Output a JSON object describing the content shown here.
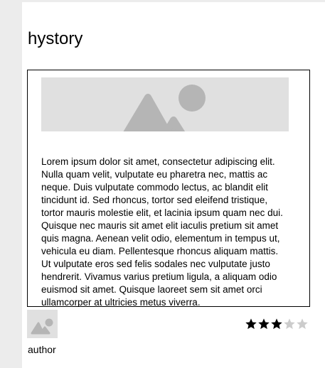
{
  "title": "hystory",
  "card": {
    "image_icon": "image-placeholder-icon",
    "body": "Lorem ipsum dolor sit amet, consectetur adipiscing elit. Nulla quam velit, vulputate eu pharetra nec, mattis ac neque. Duis vulputate commodo lectus, ac blandit elit tincidunt id. Sed rhoncus, tortor sed eleifend tristique, tortor mauris molestie elit, et lacinia ipsum quam nec dui. Quisque nec mauris sit amet elit iaculis pretium sit amet quis magna. Aenean velit odio, elementum in tempus ut, vehicula eu diam. Pellentesque rhoncus aliquam mattis. Ut vulputate eros sed felis sodales nec vulputate justo hendrerit. Vivamus varius pretium ligula, a aliquam odio euismod sit amet. Quisque laoreet sem sit amet orci ullamcorper at ultricies metus viverra."
  },
  "author": {
    "avatar_icon": "image-placeholder-icon",
    "label": "author"
  },
  "rating": {
    "value": 3,
    "max": 5,
    "filled_color": "#000000",
    "empty_color": "#cccccc"
  },
  "colors": {
    "page_background": "#ececec",
    "panel_background": "#ffffff",
    "placeholder_background": "#e0e0e0",
    "placeholder_shape": "#b5b5b5"
  }
}
